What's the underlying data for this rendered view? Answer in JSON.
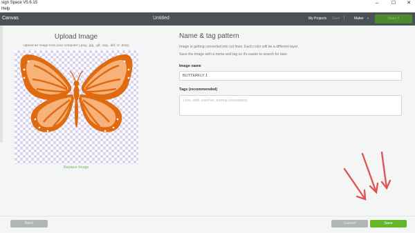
{
  "os": {
    "title": "sign Space  V5.6.15",
    "menu_item": "Help",
    "controls": [
      "–",
      "☐",
      "✕"
    ]
  },
  "header": {
    "canvas": "Canvas",
    "title": "Untitled",
    "my_projects": "My Projects",
    "save": "Save",
    "separator": "|",
    "machine": "Maker",
    "chevron": "⌄",
    "make_it": "Make It",
    "background": "#4b5257"
  },
  "upload": {
    "title": "Upload Image",
    "subtitle": "Upload an image from your computer (.png, .jpg, .gif, .svg, .dxf, or .bmp)",
    "replace_link": "Replace Image"
  },
  "name_tag": {
    "title": "Name & tag pattern",
    "desc1": "Image is getting converted into cut lines. Each color will be a different layer.",
    "desc2": "Save the image with a name and tag so it's easier to search for later.",
    "image_name_label": "Image name",
    "image_name_value": "BUTTERFLY 1",
    "tags_label": "Tags (recommended)",
    "tags_placeholder": "Lion, wild, panther, animal (examples)"
  },
  "footer": {
    "back": "Back",
    "cancel": "Cancel",
    "save": "Save"
  },
  "colors": {
    "accent_green": "#62b826",
    "butterfly_dark": "#e06a10",
    "butterfly_light": "#f7b27a",
    "arrow_red": "#e05454"
  }
}
